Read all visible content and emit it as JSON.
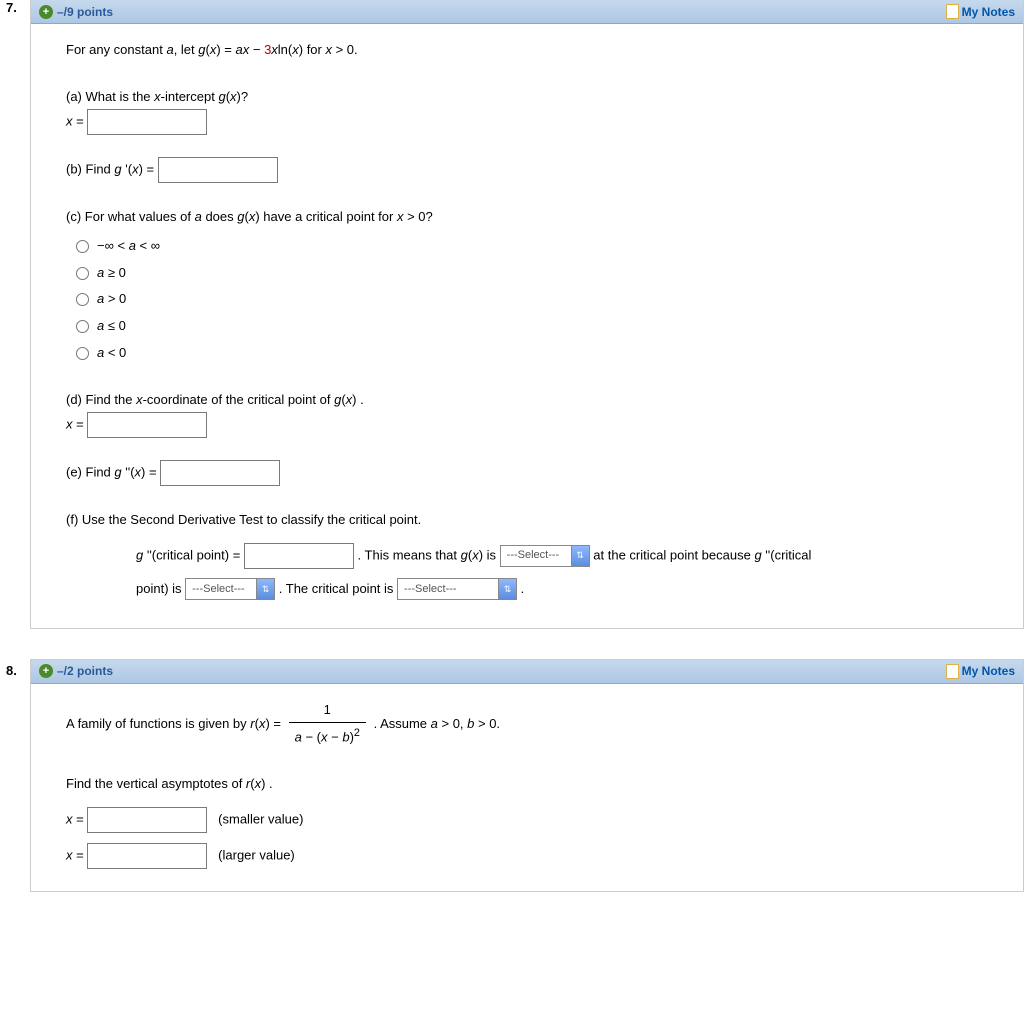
{
  "q7": {
    "number": "7.",
    "points": "–/9 points",
    "notes_label": "My Notes",
    "intro_pre": "For any constant ",
    "intro_a": "a",
    "intro_mid": ", let  ",
    "intro_g": "g",
    "intro_gx": "(",
    "intro_x1": "x",
    "intro_gx2": ") = ",
    "intro_ax_a": "a",
    "intro_ax_x": "x",
    "intro_minus": " − ",
    "intro_3": "3",
    "intro_xln_x1": "x",
    "intro_ln": "ln(",
    "intro_xln_x2": "x",
    "intro_lnclose": ")  for  ",
    "intro_x3": "x",
    "intro_gt0": " > 0.",
    "a": {
      "q_pre": "(a) What is the ",
      "q_x": "x",
      "q_mid": "-intercept  ",
      "q_g": "g",
      "q_paren1": "(",
      "q_gx": "x",
      "q_paren2": ")?",
      "label_x": "x",
      "label_eq": " = "
    },
    "b": {
      "pre": "(b) Find ",
      "g": "g ",
      "prime": "'(",
      "x": "x",
      "close": ") = "
    },
    "c": {
      "pre": "(c) For what values of ",
      "a": "a",
      "mid": " does  ",
      "g": "g",
      "p1": "(",
      "x": "x",
      "p2": ")  have a critical point for  ",
      "x2": "x",
      "gt": " > 0?",
      "opt1_pre": "−∞ < ",
      "opt1_a": "a",
      "opt1_post": " < ∞",
      "opt2_a": "a",
      "opt2_post": " ≥ 0",
      "opt3_a": "a",
      "opt3_post": " > 0",
      "opt4_a": "a",
      "opt4_post": " ≤ 0",
      "opt5_a": "a",
      "opt5_post": " < 0"
    },
    "d": {
      "pre": "(d) Find the ",
      "x": "x",
      "mid": "-coordinate of the critical point of  ",
      "g": "g",
      "p1": "(",
      "gx": "x",
      "p2": ") .",
      "label_x": "x",
      "label_eq": " = "
    },
    "e": {
      "pre": "(e) Find ",
      "g": "g ",
      "pp": "''(",
      "x": "x",
      "close": ") = "
    },
    "f": {
      "q": "(f) Use the Second Derivative Test to classify the critical point.",
      "l1_g": "g ",
      "l1_pp": "''(critical point) = ",
      "l1_mid": " . This means that ",
      "l1_g2": "g",
      "l1_p1": "(",
      "l1_x": "x",
      "l1_p2": ") is  ",
      "sel_placeholder": "---Select---",
      "l1_tail": " at the critical point because ",
      "l1_g3": "g ",
      "l1_pp2": "''(critical",
      "l2_pre": "point) is  ",
      "l2_mid": " . The critical point is  ",
      "l2_dot": " ."
    }
  },
  "q8": {
    "number": "8.",
    "points": "–/2 points",
    "notes_label": "My Notes",
    "intro_pre": "A family of functions is given by  ",
    "intro_r": "r",
    "intro_p1": "(",
    "intro_x": "x",
    "intro_p2": ") = ",
    "frac_num": "1",
    "frac_den_a": "a",
    "frac_den_mid": " − (",
    "frac_den_x": "x",
    "frac_den_mid2": " − ",
    "frac_den_b": "b",
    "frac_den_close": ")",
    "frac_den_sq": "2",
    "intro_tail": " . Assume ",
    "intro_a": "a",
    "intro_agt": " > 0, ",
    "intro_b": "b",
    "intro_bgt": " > 0.",
    "find_pre": "Find the vertical asymptotes of  ",
    "find_r": "r",
    "find_p1": "(",
    "find_x": "x",
    "find_p2": ") .",
    "x1_label_x": "x",
    "x1_label_eq": " = ",
    "x1_note": "(smaller value)",
    "x2_label_x": "x",
    "x2_label_eq": " = ",
    "x2_note": "(larger value)"
  }
}
